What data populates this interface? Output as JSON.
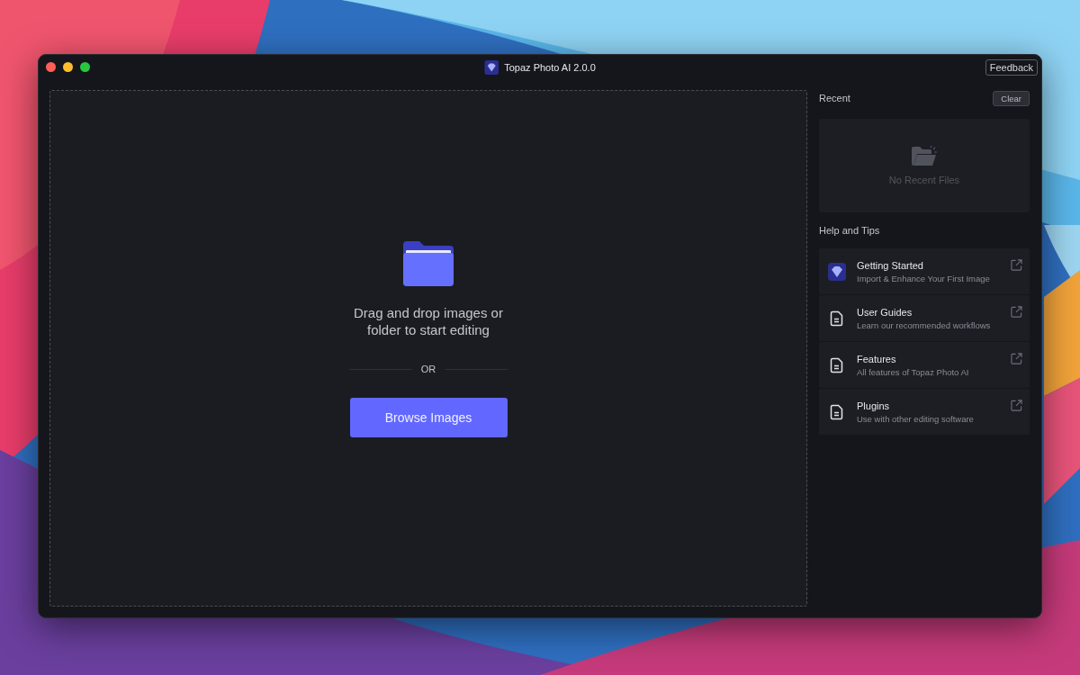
{
  "window": {
    "title": "Topaz Photo AI 2.0.0",
    "feedback_button": "Feedback"
  },
  "drop_zone": {
    "message": "Drag and drop images or folder to start editing",
    "separator": "OR",
    "browse_button": "Browse Images"
  },
  "recent": {
    "heading": "Recent",
    "clear_button": "Clear",
    "empty_text": "No Recent Files"
  },
  "help": {
    "heading": "Help and Tips",
    "items": [
      {
        "kind": "app",
        "title": "Getting Started",
        "subtitle": "Import & Enhance Your First Image"
      },
      {
        "kind": "document",
        "title": "User Guides",
        "subtitle": "Learn our recommended workflows"
      },
      {
        "kind": "document",
        "title": "Features",
        "subtitle": "All features of Topaz Photo AI"
      },
      {
        "kind": "document",
        "title": "Plugins",
        "subtitle": "Use with other editing software"
      }
    ]
  }
}
